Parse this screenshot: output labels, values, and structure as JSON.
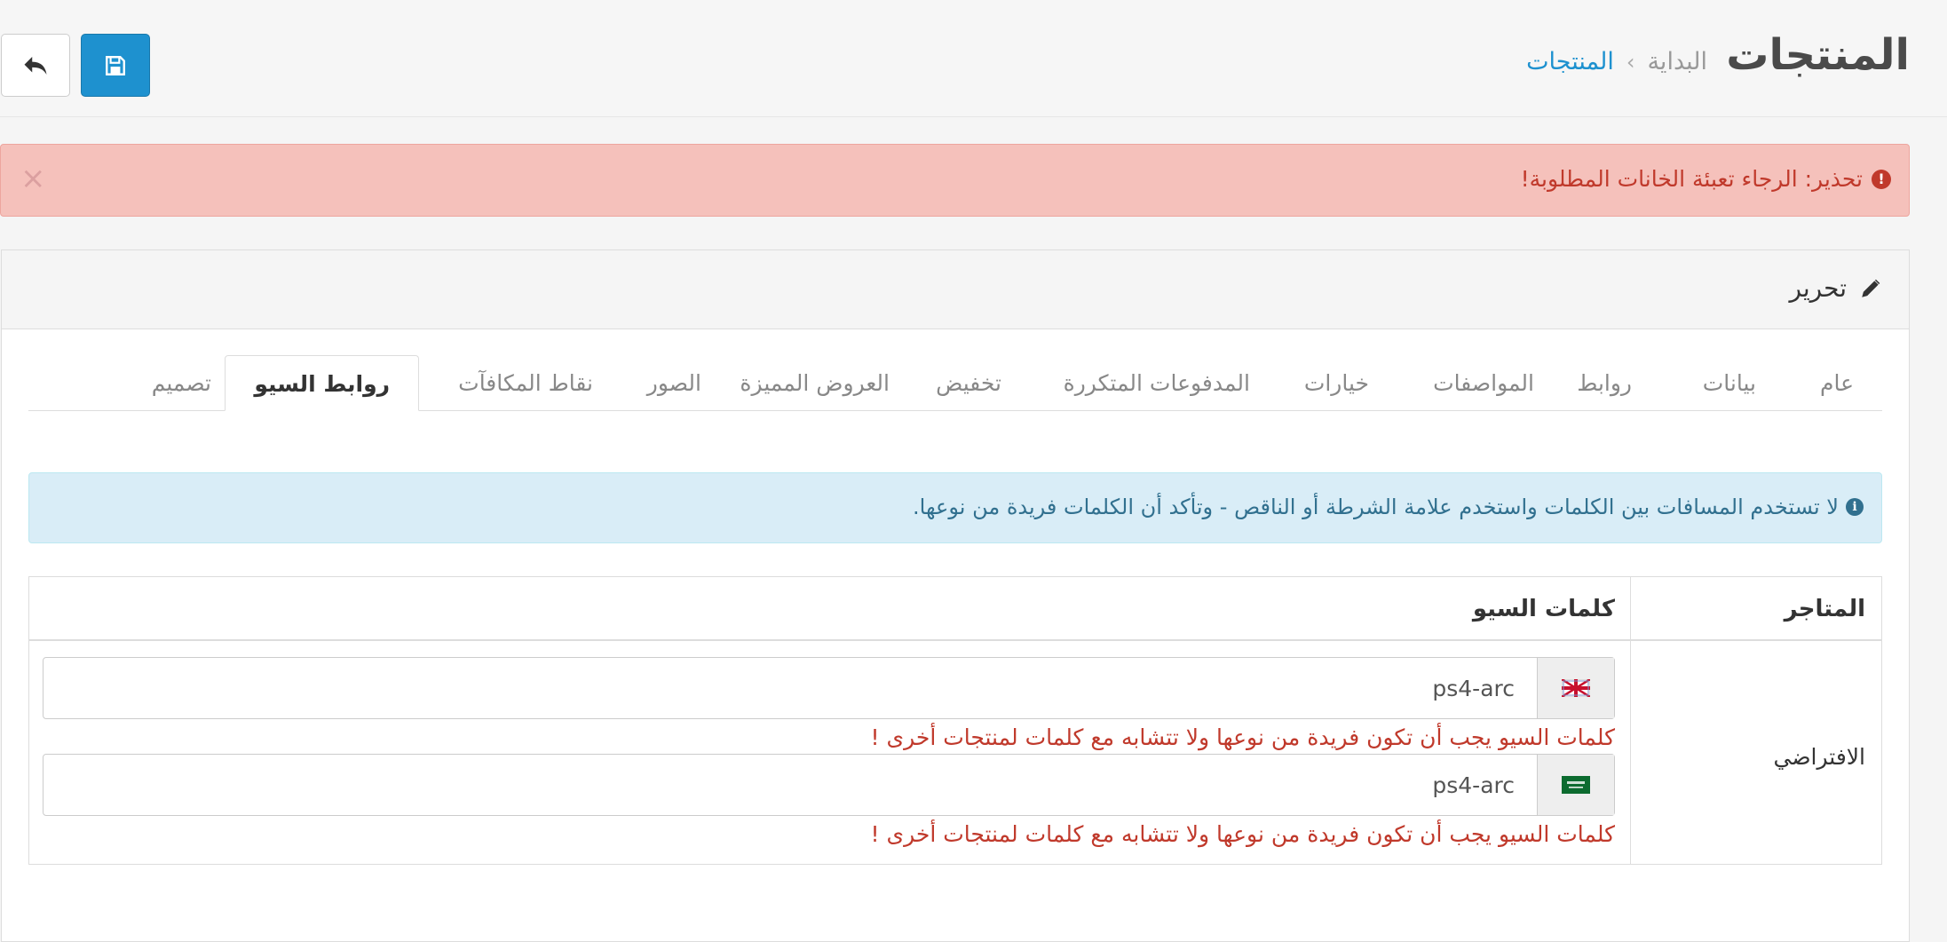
{
  "header": {
    "title": "المنتجات",
    "breadcrumb": {
      "home": "البداية",
      "separator": "›",
      "current": "المنتجات"
    },
    "save_icon": "save-icon",
    "back_icon": "reply-icon"
  },
  "alert": {
    "text": "تحذير: الرجاء تعبئة الخانات المطلوبة!",
    "icon": "exclamation-circle-icon",
    "close": "×"
  },
  "panel": {
    "title": "تحرير",
    "title_icon": "pencil-icon"
  },
  "tabs": [
    {
      "label": "عام"
    },
    {
      "label": "بيانات"
    },
    {
      "label": "روابط"
    },
    {
      "label": "المواصفات"
    },
    {
      "label": "خيارات"
    },
    {
      "label": "المدفوعات المتكررة"
    },
    {
      "label": "تخفيض"
    },
    {
      "label": "العروض المميزة"
    },
    {
      "label": "الصور"
    },
    {
      "label": "نقاط المكافآت"
    },
    {
      "label": "روابط السيو",
      "active": true
    },
    {
      "label": "تصميم"
    }
  ],
  "info": {
    "text": "لا تستخدم المسافات بين الكلمات واستخدم علامة الشرطة أو الناقص - وتأكد أن الكلمات فريدة من نوعها.",
    "icon": "info-circle-icon"
  },
  "seo_table": {
    "headers": {
      "store": "المتاجر",
      "keywords": "كلمات السيو"
    },
    "store_name": "الافتراضي",
    "rows": [
      {
        "flag": "uk-flag-icon",
        "value": "ps4-arc",
        "error": "كلمات السيو يجب أن تكون فريدة من نوعها ولا تتشابه مع كلمات لمنتجات أخرى !"
      },
      {
        "flag": "saudi-flag-icon",
        "value": "ps4-arc",
        "error": "كلمات السيو يجب أن تكون فريدة من نوعها ولا تتشابه مع كلمات لمنتجات أخرى !"
      }
    ]
  },
  "colors": {
    "primary": "#1e91cf",
    "danger_bg": "#f5c1bb",
    "danger_text": "#c0392b",
    "info_bg": "#d9edf7",
    "info_text": "#31708f"
  }
}
